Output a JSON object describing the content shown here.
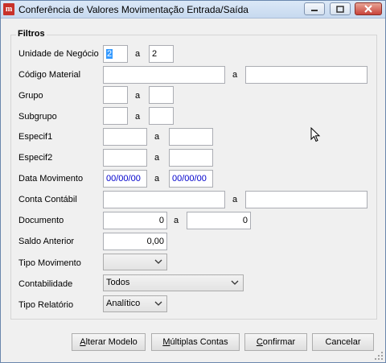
{
  "window": {
    "title": "Conferência de Valores Movimentação Entrada/Saída",
    "app_icon_glyph": "m"
  },
  "filters": {
    "group_title": "Filtros",
    "range_separator": "a",
    "unidade_negocio": {
      "label": "Unidade de Negócio",
      "from": "2",
      "to": "2"
    },
    "codigo_material": {
      "label": "Código Material",
      "from": "",
      "to": ""
    },
    "grupo": {
      "label": "Grupo",
      "from": "",
      "to": ""
    },
    "subgrupo": {
      "label": "Subgrupo",
      "from": "",
      "to": ""
    },
    "especif1": {
      "label": "Especif1",
      "from": "",
      "to": ""
    },
    "especif2": {
      "label": "Especif2",
      "from": "",
      "to": ""
    },
    "data_movimento": {
      "label": "Data Movimento",
      "from": "00/00/00",
      "to": "00/00/00"
    },
    "conta_contabil": {
      "label": "Conta Contábil",
      "from": "",
      "to": ""
    },
    "documento": {
      "label": "Documento",
      "from": "0",
      "to": "0"
    },
    "saldo_anterior": {
      "label": "Saldo Anterior",
      "value": "0,00"
    },
    "tipo_movimento": {
      "label": "Tipo Movimento",
      "selected": ""
    },
    "contabilidade": {
      "label": "Contabilidade",
      "selected": "Todos"
    },
    "tipo_relatorio": {
      "label": "Tipo Relatório",
      "selected": "Analítico"
    }
  },
  "buttons": {
    "alterar_modelo": {
      "hotkey": "A",
      "rest": "lterar Modelo"
    },
    "multiplas_contas": {
      "hotkey": "M",
      "rest": "últiplas Contas"
    },
    "confirmar": {
      "hotkey": "C",
      "rest": "onfirmar"
    },
    "cancelar": {
      "hotkey": "",
      "rest": "Cancelar"
    }
  },
  "icons": {
    "minimize": "minimize-icon",
    "maximize": "maximize-icon",
    "close": "close-icon",
    "dropdown": "chevron-down-icon",
    "cursor": "mouse-pointer-icon"
  },
  "colors": {
    "title_bar": "#c7d9ef",
    "close_button": "#c8433a",
    "selection": "#3399ff",
    "date_text": "#0000cc"
  }
}
